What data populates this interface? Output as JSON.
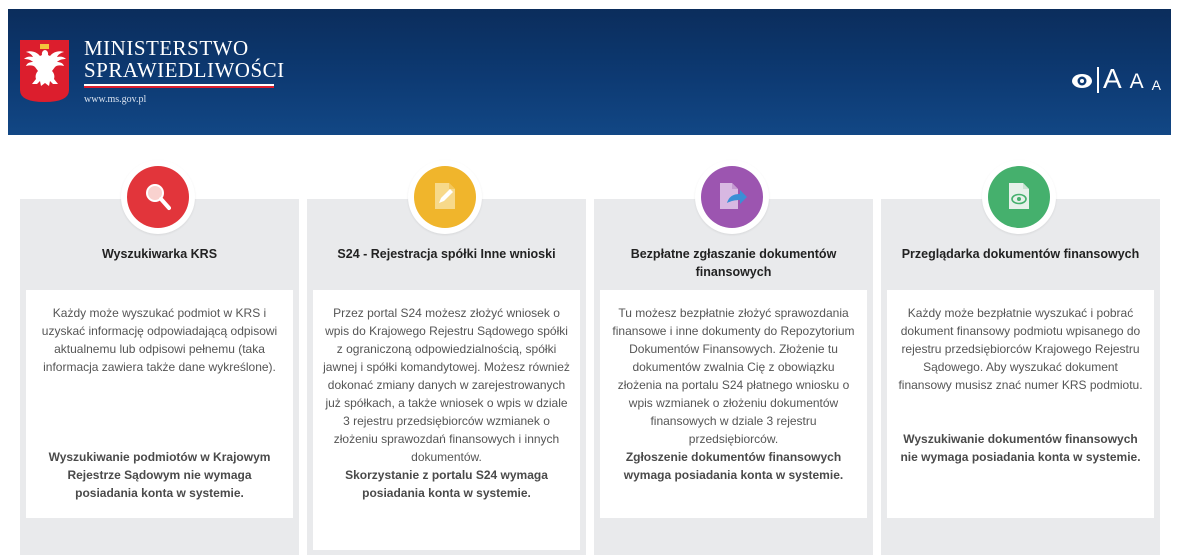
{
  "header": {
    "brand_line1": "MINISTERSTWO",
    "brand_line2": "SPRAWIEDLIWOŚCI",
    "url": "www.ms.gov.pl",
    "font_large": "A",
    "font_medium": "A",
    "font_small": "A"
  },
  "colors": {
    "header_bg": "#0d3a73",
    "red": "#e2353b",
    "yellow": "#f0b52c",
    "purple": "#9c55b0",
    "green": "#45b06d",
    "card_bg": "#e9eaec"
  },
  "cards": [
    {
      "icon": "search-icon",
      "title": "Wyszukiwarka KRS",
      "body": "Każdy może wyszukać podmiot w KRS i uzyskać informację odpowiadającą odpisowi aktualnemu lub odpisowi pełnemu (taka informacja zawiera także dane wykreślone).",
      "note": "Wyszukiwanie podmiotów w Krajowym Rejestrze Sądowym nie wymaga posiadania konta w systemie."
    },
    {
      "icon": "edit-document-icon",
      "title": "S24 - Rejestracja spółki Inne wnioski",
      "body": "Przez portal S24 możesz złożyć wniosek o wpis do Krajowego Rejestru Sądowego spółki z ograniczoną odpowiedzialnością, spółki jawnej i spółki komandytowej. Możesz również dokonać zmiany danych w zarejestrowanych już spółkach, a także wniosek o wpis w dziale 3 rejestru przedsiębiorców wzmianek o złożeniu sprawozdań finansowych i innych dokumentów.",
      "note": "Skorzystanie z portalu S24 wymaga posiadania konta w systemie."
    },
    {
      "icon": "send-document-icon",
      "title": "Bezpłatne zgłaszanie dokumentów finansowych",
      "body": "Tu możesz bezpłatnie złożyć sprawozdania finansowe i inne dokumenty do Repozytorium Dokumentów Finansowych. Złożenie tu dokumentów zwalnia Cię z obowiązku złożenia na portalu S24 płatnego wniosku o wpis wzmianek o złożeniu dokumentów finansowych w dziale 3 rejestru przedsiębiorców.",
      "note": "Zgłoszenie dokumentów finansowych wymaga posiadania konta w systemie."
    },
    {
      "icon": "view-document-icon",
      "title": "Przeglądarka dokumentów finansowych",
      "body": "Każdy może bezpłatnie wyszukać i pobrać dokument finansowy podmiotu wpisanego do rejestru przedsiębiorców Krajowego Rejestru Sądowego. Aby wyszukać dokument finansowy musisz znać numer KRS podmiotu.",
      "note": "Wyszukiwanie dokumentów finansowych nie wymaga posiadania konta w systemie."
    }
  ]
}
